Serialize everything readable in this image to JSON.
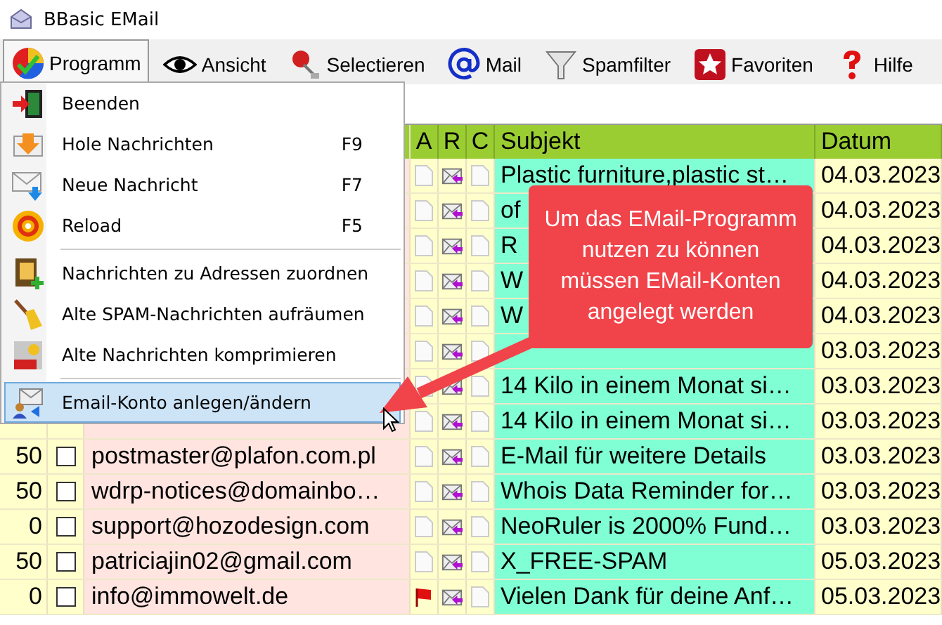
{
  "window": {
    "title": "BBasic EMail"
  },
  "toolbar": [
    {
      "label": "Programm",
      "selected": true
    },
    {
      "label": "Ansicht",
      "selected": false
    },
    {
      "label": "Selectieren",
      "selected": false
    },
    {
      "label": "Mail",
      "selected": false
    },
    {
      "label": "Spamfilter",
      "selected": false
    },
    {
      "label": "Favoriten",
      "selected": false
    },
    {
      "label": "Hilfe",
      "selected": false
    }
  ],
  "menu": {
    "groups": [
      [
        {
          "label": "Beenden",
          "selected": false
        },
        {
          "label": "Hole Nachrichten",
          "shortcut": "F9",
          "selected": false
        },
        {
          "label": "Neue Nachricht",
          "shortcut": "F7",
          "selected": false
        },
        {
          "label": "Reload",
          "shortcut": "F5",
          "selected": false
        }
      ],
      [
        {
          "label": "Nachrichten zu Adressen zuordnen",
          "selected": false
        },
        {
          "label": "Alte SPAM-Nachrichten aufräumen",
          "selected": false
        },
        {
          "label": "Alte Nachrichten komprimieren",
          "selected": false
        }
      ],
      [
        {
          "label": "Email-Konto anlegen/ändern",
          "selected": true
        }
      ]
    ]
  },
  "table": {
    "columns": [
      "A",
      "R",
      "C",
      "Subjekt",
      "Datum"
    ],
    "rows": [
      {
        "subject": "Plastic furniture,plastic st…",
        "date": "04.03.2023",
        "flagged": false
      },
      {
        "subject": "of",
        "date": "04.03.2023",
        "flagged": false
      },
      {
        "subject": "R",
        "date": "04.03.2023",
        "flagged": false
      },
      {
        "subject": "W",
        "date": "04.03.2023",
        "flagged": false
      },
      {
        "subject": "W",
        "date": "04.03.2023",
        "flagged": false
      },
      {
        "date": "03.03.2023",
        "flagged": false
      },
      {
        "subject": "14 Kilo in einem Monat si…",
        "date": "03.03.2023",
        "flagged": false
      },
      {
        "subject": "14 Kilo in einem Monat si…",
        "date": "03.03.2023",
        "flagged": false
      },
      {
        "score": "50",
        "checked": false,
        "sender": "postmaster@plafon.com.pl",
        "subject": "E-Mail für weitere Details",
        "date": "03.03.2023",
        "flagged": false
      },
      {
        "score": "50",
        "checked": false,
        "sender": "wdrp-notices@domainbo…",
        "subject": "Whois Data Reminder for…",
        "date": "03.03.2023",
        "flagged": false
      },
      {
        "score": "0",
        "checked": false,
        "sender": "support@hozodesign.com",
        "subject": "NeoRuler is 2000% Fund…",
        "date": "03.03.2023",
        "flagged": false
      },
      {
        "score": "50",
        "checked": false,
        "sender": "patriciajin02@gmail.com",
        "subject": "X_FREE-SPAM",
        "date": "05.03.2023",
        "flagged": false
      },
      {
        "score": "0",
        "checked": false,
        "sender": "info@immowelt.de",
        "subject": "Vielen Dank für deine Anf…",
        "date": "05.03.2023",
        "flagged": true
      }
    ]
  },
  "callout": {
    "text": "Um das EMail-Programm nutzen zu können müssen EMail-Konten angelegt werden"
  }
}
